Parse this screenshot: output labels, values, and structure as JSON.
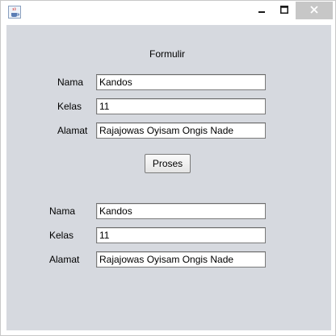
{
  "window": {
    "title": ""
  },
  "form": {
    "heading": "Formulir",
    "input": {
      "nama_label": "Nama",
      "nama_value": "Kandos",
      "kelas_label": "Kelas",
      "kelas_value": "11",
      "alamat_label": "Alamat",
      "alamat_value": "Rajajowas Oyisam Ongis Nade"
    },
    "proses_button": "Proses",
    "output": {
      "nama_label": "Nama",
      "nama_value": "Kandos",
      "kelas_label": "Kelas",
      "kelas_value": "11",
      "alamat_label": "Alamat",
      "alamat_value": "Rajajowas Oyisam Ongis Nade"
    }
  },
  "icons": {
    "app": "java-cup-icon",
    "minimize": "minimize-icon",
    "maximize": "maximize-icon",
    "close": "close-icon"
  }
}
